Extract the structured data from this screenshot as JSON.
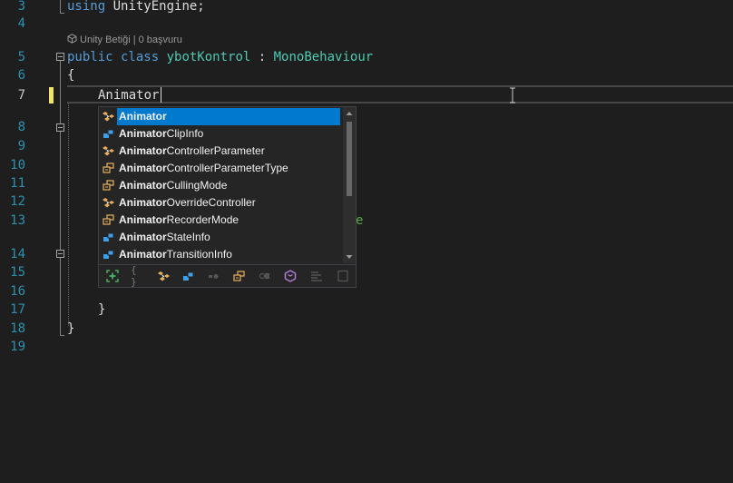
{
  "line_numbers": [
    "3",
    "4",
    "5",
    "6",
    "7",
    "8",
    "9",
    "10",
    "11",
    "12",
    "13",
    "14",
    "15",
    "16",
    "17",
    "18",
    "19"
  ],
  "code": {
    "line3_keyword": "using",
    "line3_rest": " UnityEngine;",
    "codelens": "Unity Betiği | 0 başvuru",
    "line5_public": "public",
    "line5_class": " class ",
    "line5_name": "ybotKontrol",
    "line5_colon": " : ",
    "line5_base": "MonoBehaviour",
    "line6": "{",
    "line7": "Animator",
    "line13_partial": "e",
    "line17": "}",
    "line18": "}"
  },
  "intellisense": {
    "items": [
      {
        "match": "Animator",
        "rest": "",
        "kind": "class",
        "selected": true
      },
      {
        "match": "Animator",
        "rest": "ClipInfo",
        "kind": "struct",
        "selected": false
      },
      {
        "match": "Animator",
        "rest": "ControllerParameter",
        "kind": "class",
        "selected": false
      },
      {
        "match": "Animator",
        "rest": "ControllerParameterType",
        "kind": "enum",
        "selected": false
      },
      {
        "match": "Animator",
        "rest": "CullingMode",
        "kind": "enum",
        "selected": false
      },
      {
        "match": "Animator",
        "rest": "OverrideController",
        "kind": "class",
        "selected": false
      },
      {
        "match": "Animator",
        "rest": "RecorderMode",
        "kind": "enum",
        "selected": false
      },
      {
        "match": "Animator",
        "rest": "StateInfo",
        "kind": "struct",
        "selected": false
      },
      {
        "match": "Animator",
        "rest": "TransitionInfo",
        "kind": "struct",
        "selected": false
      }
    ],
    "filters": [
      "add-snippet-filter-icon",
      "namespace-filter-icon",
      "class-filter-icon",
      "struct-filter-icon",
      "delegate-filter-icon",
      "enum-filter-icon",
      "interface-filter-icon",
      "module-filter-icon",
      "keyword-filter-icon",
      "snippet-filter-icon"
    ],
    "filter_glyphs": [
      "",
      "{ }",
      "",
      "",
      "",
      "",
      "",
      "",
      "",
      ""
    ]
  },
  "colors": {
    "background": "#1e1e1e",
    "line_number": "#2b91af",
    "keyword": "#569cd6",
    "type": "#4ec9b0",
    "selection": "#007acc",
    "change_marker": "#efe56a"
  }
}
